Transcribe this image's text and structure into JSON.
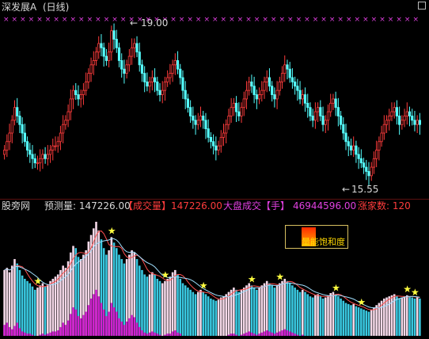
{
  "window": {
    "title": "深发展A",
    "period": "(日线)",
    "corner_icon": "box-icon"
  },
  "price_panel": {
    "high_label": "19.00",
    "low_label": "15.55",
    "high_arrow": "←",
    "low_arrow": "←",
    "marker_glyph": "×",
    "colors": {
      "up": "#ff3c3c",
      "down": "#54ffff",
      "marker": "#e040e0",
      "text": "#d8d8d8"
    }
  },
  "indicator_bar": {
    "source": "股旁网",
    "predicted_label": "预测量:",
    "predicted_value": "147226.00",
    "volume_title": "【成交量】",
    "volume_value": "147226.00",
    "market_title": "大盘成交【手】",
    "market_value": "46944596.00",
    "up_count": "涨家数: 120"
  },
  "legend": {
    "label": "量能饱和度",
    "colors": [
      "#ff2a00",
      "#ffb000"
    ]
  },
  "chart_data": [
    {
      "type": "candlestick",
      "title": "",
      "xlabel": "",
      "ylabel": "",
      "ylim": [
        15.3,
        19.2
      ],
      "annotations": [
        {
          "text": "19.00",
          "value": 19.0,
          "day_index": 42
        },
        {
          "text": "15.55",
          "value": 15.55,
          "day_index": 143
        }
      ],
      "close": [
        16.2,
        16.4,
        16.6,
        16.9,
        17.2,
        17.0,
        16.8,
        16.6,
        16.4,
        16.2,
        16.1,
        16.0,
        15.9,
        15.9,
        16.0,
        16.1,
        16.0,
        16.1,
        16.2,
        16.3,
        16.3,
        16.4,
        16.6,
        16.8,
        16.9,
        17.1,
        17.4,
        17.6,
        17.5,
        17.4,
        17.5,
        17.6,
        17.8,
        18.0,
        18.2,
        18.3,
        18.5,
        18.7,
        18.6,
        18.4,
        18.3,
        18.5,
        19.0,
        18.8,
        18.6,
        18.3,
        18.1,
        18.0,
        18.2,
        18.4,
        18.6,
        18.7,
        18.5,
        18.2,
        18.0,
        17.8,
        17.7,
        17.8,
        17.9,
        17.8,
        17.6,
        17.5,
        17.6,
        17.8,
        17.9,
        18.0,
        18.2,
        18.3,
        18.1,
        17.9,
        17.6,
        17.4,
        17.2,
        17.0,
        16.9,
        16.8,
        16.9,
        17.0,
        16.9,
        16.7,
        16.5,
        16.4,
        16.3,
        16.2,
        16.3,
        16.5,
        16.6,
        16.8,
        17.0,
        17.2,
        17.3,
        17.1,
        17.0,
        17.2,
        17.4,
        17.6,
        17.8,
        17.7,
        17.5,
        17.4,
        17.5,
        17.6,
        17.8,
        17.9,
        17.7,
        17.5,
        17.4,
        17.6,
        17.8,
        18.0,
        18.2,
        18.1,
        17.9,
        17.8,
        17.7,
        17.6,
        17.4,
        17.5,
        17.3,
        17.2,
        17.0,
        16.9,
        17.1,
        17.2,
        17.0,
        16.8,
        16.9,
        17.1,
        17.3,
        17.4,
        17.2,
        17.0,
        16.8,
        16.6,
        16.4,
        16.3,
        16.2,
        16.3,
        16.1,
        16.0,
        15.9,
        15.8,
        15.7,
        15.6,
        15.8,
        16.0,
        16.2,
        16.4,
        16.6,
        16.8,
        16.9,
        17.0,
        17.1,
        17.2,
        17.0,
        16.8,
        16.9,
        17.0,
        17.1,
        17.0,
        16.9,
        16.8,
        16.9,
        16.8
      ],
      "markers_top": 50,
      "stars_bottom": [
        13,
        42,
        63,
        78,
        97,
        108,
        130,
        140,
        158,
        161
      ]
    },
    {
      "type": "bar",
      "title": "",
      "xlabel": "",
      "ylabel": "",
      "volume": [
        60,
        62,
        58,
        64,
        70,
        66,
        60,
        55,
        52,
        50,
        48,
        45,
        42,
        44,
        46,
        48,
        45,
        47,
        50,
        52,
        54,
        56,
        60,
        64,
        62,
        68,
        76,
        82,
        80,
        72,
        70,
        74,
        78,
        86,
        92,
        98,
        104,
        96,
        88,
        80,
        74,
        78,
        90,
        85,
        80,
        74,
        70,
        66,
        70,
        74,
        78,
        76,
        70,
        64,
        60,
        56,
        54,
        56,
        58,
        56,
        52,
        50,
        48,
        50,
        52,
        54,
        58,
        60,
        56,
        52,
        48,
        46,
        44,
        42,
        40,
        38,
        40,
        42,
        40,
        38,
        36,
        34,
        33,
        32,
        33,
        35,
        36,
        38,
        40,
        42,
        44,
        42,
        40,
        42,
        44,
        46,
        48,
        46,
        44,
        42,
        44,
        46,
        48,
        50,
        48,
        46,
        44,
        46,
        48,
        50,
        52,
        50,
        48,
        46,
        44,
        42,
        40,
        42,
        40,
        38,
        36,
        35,
        37,
        38,
        36,
        34,
        35,
        37,
        39,
        40,
        38,
        36,
        34,
        32,
        30,
        29,
        28,
        29,
        27,
        26,
        25,
        24,
        23,
        22,
        24,
        26,
        28,
        30,
        32,
        34,
        35,
        36,
        37,
        38,
        36,
        34,
        35,
        36,
        37,
        36,
        35,
        34,
        35,
        34
      ],
      "saturation": [
        10,
        12,
        8,
        6,
        9,
        12,
        7,
        4,
        3,
        2,
        2,
        1,
        0,
        0,
        1,
        2,
        1,
        2,
        3,
        4,
        4,
        5,
        8,
        12,
        10,
        14,
        20,
        26,
        24,
        18,
        16,
        19,
        22,
        28,
        34,
        38,
        42,
        36,
        30,
        24,
        18,
        22,
        30,
        26,
        22,
        16,
        13,
        10,
        13,
        16,
        19,
        17,
        12,
        8,
        5,
        3,
        2,
        3,
        4,
        3,
        2,
        1,
        0,
        1,
        2,
        2,
        4,
        5,
        3,
        2,
        0,
        0,
        0,
        0,
        0,
        0,
        0,
        0,
        0,
        0,
        0,
        0,
        0,
        0,
        0,
        0,
        0,
        0,
        1,
        2,
        2,
        1,
        0,
        1,
        2,
        3,
        4,
        3,
        2,
        1,
        2,
        3,
        4,
        5,
        4,
        3,
        2,
        3,
        4,
        5,
        6,
        5,
        4,
        3,
        2,
        1,
        0,
        1,
        0,
        0,
        0,
        0,
        0,
        0,
        0,
        0,
        0,
        0,
        0,
        0,
        0,
        0,
        0,
        0,
        0,
        0,
        0,
        0,
        0,
        0,
        0,
        0,
        0,
        0,
        0,
        0,
        0,
        0,
        0,
        0,
        0,
        0,
        0,
        0,
        0,
        0,
        0,
        0,
        0,
        0,
        0,
        0,
        0,
        0
      ]
    }
  ]
}
